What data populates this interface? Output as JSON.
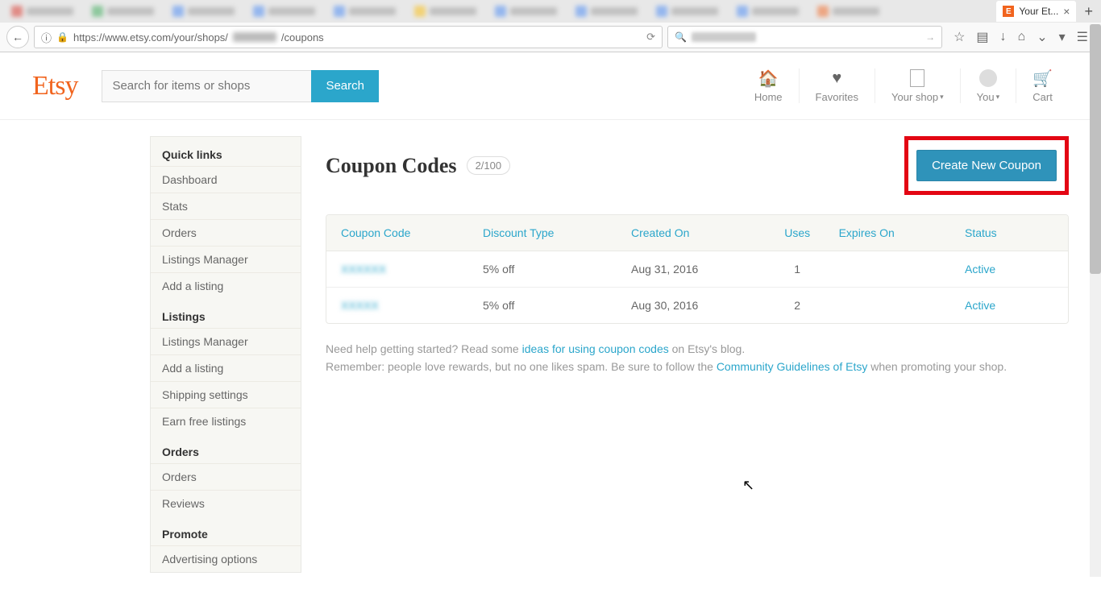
{
  "browser": {
    "active_tab_title": "Your Et...",
    "url_display": "https://www.etsy.com/your/shops/",
    "url_suffix": "/coupons",
    "blur_tabs": [
      {
        "fav": "#d93025"
      },
      {
        "fav": "#34a853"
      },
      {
        "fav": "#4285f4"
      },
      {
        "fav": "#4285f4"
      },
      {
        "fav": "#4285f4"
      },
      {
        "fav": "#fbbc04"
      },
      {
        "fav": "#4285f4"
      },
      {
        "fav": "#4285f4"
      },
      {
        "fav": "#4285f4"
      },
      {
        "fav": "#4285f4"
      },
      {
        "fav": "#f1641e"
      }
    ]
  },
  "header": {
    "logo": "Etsy",
    "search_placeholder": "Search for items or shops",
    "search_button": "Search",
    "nav": {
      "home": "Home",
      "favorites": "Favorites",
      "your_shop": "Your shop",
      "you": "You",
      "cart": "Cart"
    }
  },
  "sidebar": {
    "groups": [
      {
        "title": "Quick links",
        "items": [
          "Dashboard",
          "Stats",
          "Orders",
          "Listings Manager",
          "Add a listing"
        ]
      },
      {
        "title": "Listings",
        "items": [
          "Listings Manager",
          "Add a listing",
          "Shipping settings",
          "Earn free listings"
        ]
      },
      {
        "title": "Orders",
        "items": [
          "Orders",
          "Reviews"
        ]
      },
      {
        "title": "Promote",
        "items": [
          "Advertising options"
        ]
      }
    ]
  },
  "main": {
    "title": "Coupon Codes",
    "count": "2/100",
    "create_button": "Create New Coupon",
    "columns": {
      "code": "Coupon Code",
      "type": "Discount Type",
      "created": "Created On",
      "uses": "Uses",
      "expires": "Expires On",
      "status": "Status"
    },
    "rows": [
      {
        "code": "XXXXXX",
        "type": "5% off",
        "created": "Aug 31, 2016",
        "uses": "1",
        "expires": "",
        "status": "Active"
      },
      {
        "code": "XXXXX",
        "type": "5% off",
        "created": "Aug 30, 2016",
        "uses": "2",
        "expires": "",
        "status": "Active"
      }
    ],
    "help": {
      "t1": "Need help getting started? Read some ",
      "link1": "ideas for using coupon codes",
      "t2": " on Etsy's blog.",
      "t3": "Remember: people love rewards, but no one likes spam. Be sure to follow the ",
      "link2": "Community Guidelines of Etsy",
      "t4": " when promoting your shop."
    }
  }
}
